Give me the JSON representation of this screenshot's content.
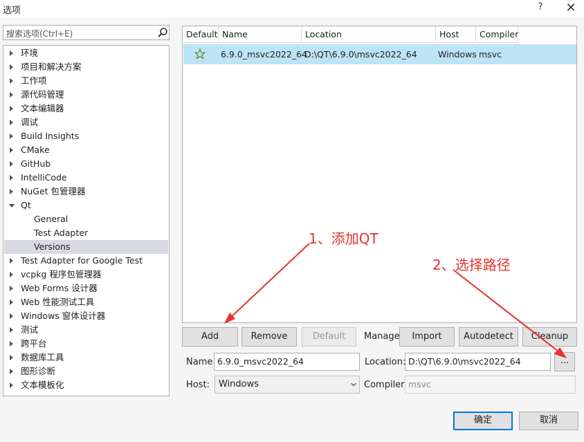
{
  "window": {
    "title": "选项",
    "help_label": "?",
    "close_label": "✕"
  },
  "search": {
    "placeholder": "搜索选项(Ctrl+E)"
  },
  "tree": {
    "items": [
      {
        "label": "环境",
        "expanded": false
      },
      {
        "label": "项目和解决方案",
        "expanded": false
      },
      {
        "label": "工作项",
        "expanded": false
      },
      {
        "label": "源代码管理",
        "expanded": false
      },
      {
        "label": "文本编辑器",
        "expanded": false
      },
      {
        "label": "调试",
        "expanded": false
      },
      {
        "label": "Build Insights",
        "expanded": false
      },
      {
        "label": "CMake",
        "expanded": false
      },
      {
        "label": "GitHub",
        "expanded": false
      },
      {
        "label": "IntelliCode",
        "expanded": false
      },
      {
        "label": "NuGet 包管理器",
        "expanded": false
      },
      {
        "label": "Qt",
        "expanded": true
      },
      {
        "label": "General",
        "child": true
      },
      {
        "label": "Test Adapter",
        "child": true
      },
      {
        "label": "Versions",
        "child": true,
        "selected": true
      },
      {
        "label": "Test Adapter for Google Test",
        "expanded": false
      },
      {
        "label": "vcpkg 程序包管理器",
        "expanded": false
      },
      {
        "label": "Web Forms 设计器",
        "expanded": false
      },
      {
        "label": "Web 性能测试工具",
        "expanded": false
      },
      {
        "label": "Windows 窗体设计器",
        "expanded": false
      },
      {
        "label": "测试",
        "expanded": false
      },
      {
        "label": "跨平台",
        "expanded": false
      },
      {
        "label": "数据库工具",
        "expanded": false
      },
      {
        "label": "图形诊断",
        "expanded": false
      },
      {
        "label": "文本模板化",
        "expanded": false
      }
    ]
  },
  "versions_table": {
    "columns": [
      "Default",
      "Name",
      "Location",
      "Host",
      "Compiler"
    ],
    "rows": [
      {
        "default_icon": "star-icon",
        "name": "6.9.0_msvc2022_64",
        "location": "D:\\QT\\6.9.0\\msvc2022_64",
        "host": "Windows",
        "compiler": "msvc"
      }
    ]
  },
  "buttons": {
    "add": "Add",
    "remove": "Remove",
    "default": "Default",
    "manage_label": "Manage",
    "import": "Import",
    "autodetect": "Autodetect",
    "cleanup": "Cleanup",
    "browse": "...",
    "ok": "确定",
    "cancel": "取消"
  },
  "form": {
    "name_label": "Name:",
    "name_value": "6.9.0_msvc2022_64",
    "location_label": "Location:",
    "location_value": "D:\\QT\\6.9.0\\msvc2022_64",
    "host_label": "Host:",
    "host_value": "Windows",
    "compiler_label": "Compiler:",
    "compiler_value": "msvc"
  },
  "annotations": {
    "step1": "1、添加QT",
    "step2": "2、选择路径",
    "color": "#e8312b"
  },
  "colors": {
    "selection_row": "#bde3f7",
    "tree_selection": "#d8d9e1",
    "accent_border": "#0078d7"
  }
}
